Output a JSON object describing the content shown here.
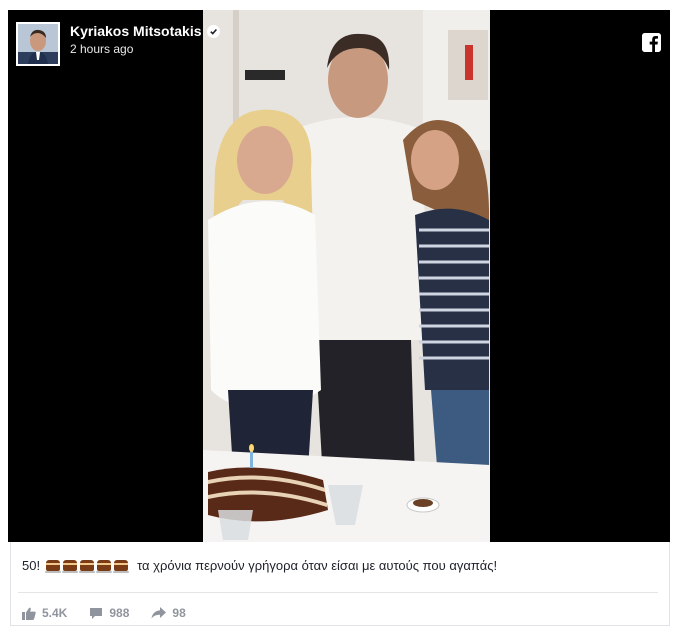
{
  "post": {
    "author": "Kyriakos Mitsotakis",
    "time": "2 hours ago",
    "caption_prefix": "50!",
    "caption_text": "τα χρόνια περνούν γρήγορα όταν είσαι με αυτούς που αγαπάς!",
    "cake_icon": "birthday-cake-icon",
    "cake_count": 5
  },
  "reactions": {
    "likes": "5.4K",
    "comments": "988",
    "shares": "98"
  },
  "colors": {
    "text": "#1d2129",
    "meta": "#90949c",
    "media_bg": "#000000"
  }
}
